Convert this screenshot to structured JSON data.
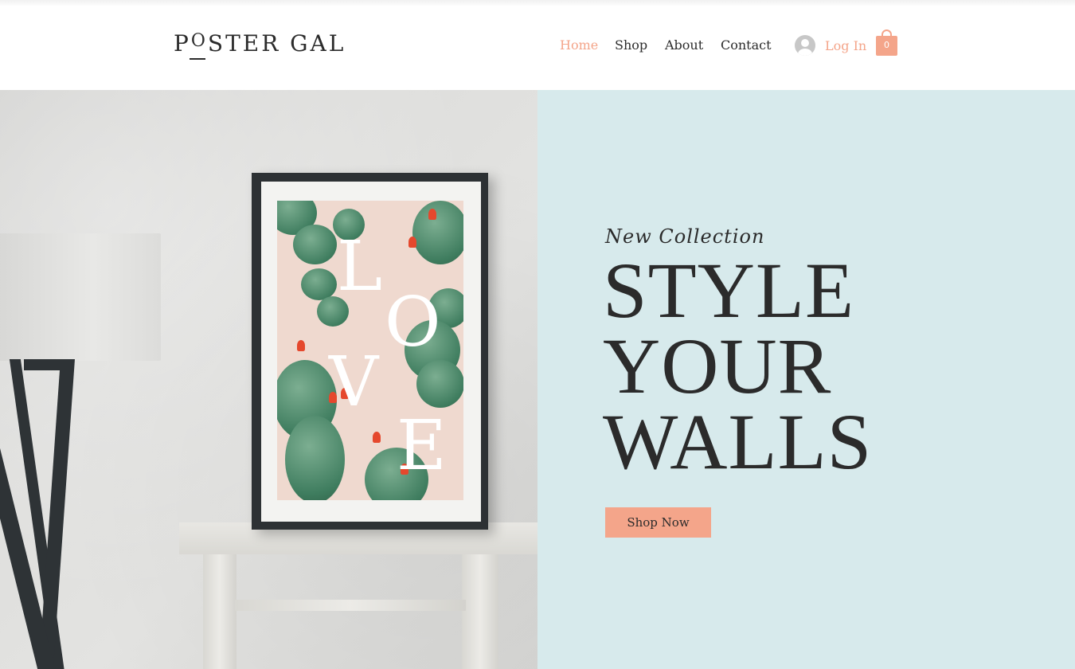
{
  "header": {
    "logo": {
      "first": "P",
      "o": "O",
      "rest": "STER GAL"
    },
    "nav": [
      {
        "label": "Home",
        "active": true
      },
      {
        "label": "Shop",
        "active": false
      },
      {
        "label": "About",
        "active": false
      },
      {
        "label": "Contact",
        "active": false
      }
    ],
    "login_label": "Log In",
    "cart_count": "0"
  },
  "hero": {
    "image": {
      "poster_letters": [
        "L",
        "O",
        "V",
        "E"
      ]
    },
    "subtitle": "New Collection",
    "headline": [
      "STYLE",
      "YOUR",
      "WALLS"
    ],
    "cta_label": "Shop Now"
  },
  "colors": {
    "accent": "#f4a58a",
    "hero_background": "#d7eaec",
    "text": "#2b2b2b"
  },
  "icons": {
    "user": "user-avatar-icon",
    "cart": "shopping-bag-icon"
  }
}
